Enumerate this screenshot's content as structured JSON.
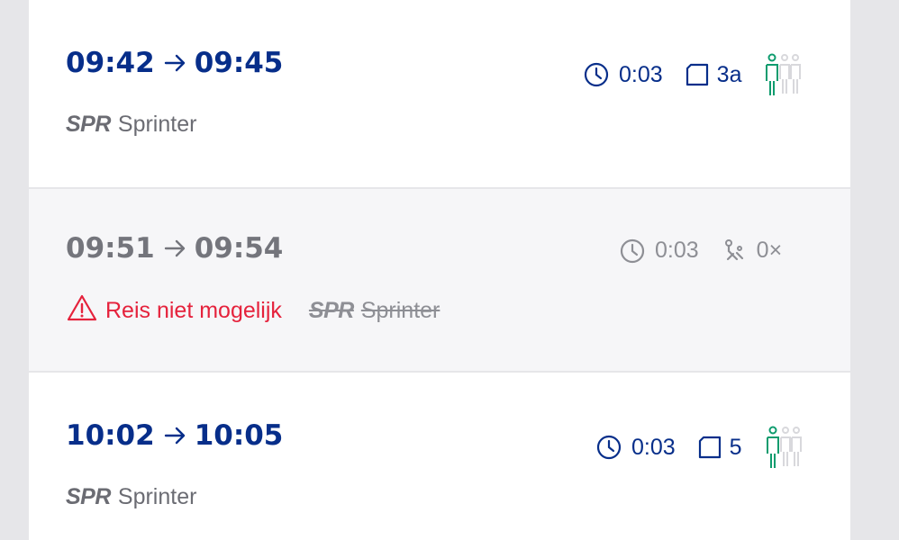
{
  "trips": [
    {
      "departure": "09:42",
      "arrival": "09:45",
      "duration": "0:03",
      "platform": "3a",
      "product_code": "SPR",
      "product_name": "Sprinter",
      "crowding_level": 1,
      "crowding_max": 3
    },
    {
      "departure": "09:51",
      "arrival": "09:54",
      "duration": "0:03",
      "transfers": "0×",
      "warning": "Reis niet mogelijk",
      "product_code": "SPR",
      "product_name": "Sprinter",
      "cancelled": true
    },
    {
      "departure": "10:02",
      "arrival": "10:05",
      "duration": "0:03",
      "platform": "5",
      "product_code": "SPR",
      "product_name": "Sprinter",
      "crowding_level": 1,
      "crowding_max": 3
    }
  ],
  "colors": {
    "primary": "#072e8a",
    "muted": "#74757c",
    "error": "#e5223c",
    "crowding_active": "#0e9c6e",
    "crowding_inactive": "#d8d8dc"
  },
  "icons": {
    "duration": "clock-icon",
    "platform": "platform-icon",
    "crowding": "crowding-icon",
    "transfers": "transfer-icon",
    "warning": "warning-triangle-icon"
  }
}
